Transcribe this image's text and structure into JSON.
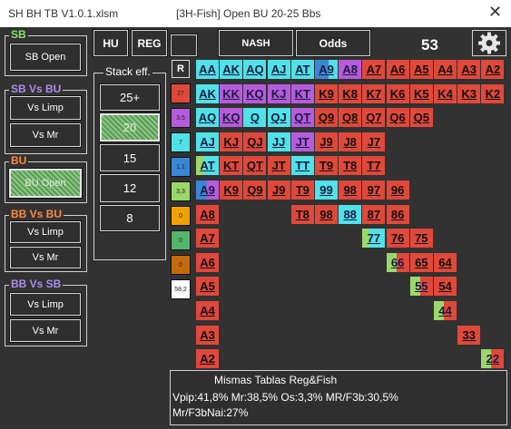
{
  "window": {
    "file_name": "SH BH TB V1.0.1.xlsm",
    "title": "[3H-Fish] Open BU 20-25 Bbs",
    "close_glyph": "✕"
  },
  "colors": {
    "raise_red": "#e0483a",
    "limp_purple": "#b65bdc",
    "call_cyan": "#50e2e8",
    "light_blue": "#3a86d8",
    "lime": "#9bd86a",
    "orange": "#f2a200",
    "green": "#55b56a"
  },
  "sidebar": {
    "sb": {
      "title": "SB",
      "open_label": "SB Open"
    },
    "sb_vs_bu": {
      "title": "SB Vs BU",
      "limp_label": "Vs Limp",
      "mr_label": "Vs Mr"
    },
    "bu": {
      "title": "BU",
      "open_label": "BU Open"
    },
    "bb_vs_bu": {
      "title": "BB Vs BU",
      "limp_label": "Vs Limp",
      "mr_label": "Vs Mr"
    },
    "bb_vs_sb": {
      "title": "BB Vs SB",
      "limp_label": "Vs Limp",
      "mr_label": "Vs Mr"
    }
  },
  "top": {
    "hu_label": "HU",
    "reg_label": "REG",
    "nash_label": "NASH",
    "odds_label": "Odds",
    "counter": "53",
    "gear_icon": "gear-icon"
  },
  "stack": {
    "title": "Stack eff.",
    "options": [
      "25+",
      "20",
      "15",
      "12",
      "8"
    ],
    "selected": "20"
  },
  "legend": {
    "header": "R",
    "values": [
      "27",
      "3,5",
      "7",
      "1,1",
      "3,3",
      "0",
      "0",
      "0",
      "58,2"
    ]
  },
  "summary": {
    "title": "Mismas Tablas Reg&Fish",
    "line1": "Vpip:41,8% Mr:38,5% Os:3,3% MR/F3b:30,5%",
    "line2": "Mr/F3bNai:27%"
  },
  "hands": [
    [
      "AA",
      "AK",
      "AQ",
      "AJ",
      "AT",
      "A9",
      "A8",
      "A7",
      "A6",
      "A5",
      "A4",
      "A3",
      "A2"
    ],
    [
      "AK",
      "KK",
      "KQ",
      "KJ",
      "KT",
      "K9",
      "K8",
      "K7",
      "K6",
      "K5",
      "K4",
      "K3",
      "K2"
    ],
    [
      "AQ",
      "KQ",
      "Q",
      "QJ",
      "QT",
      "Q9",
      "Q8",
      "Q7",
      "Q6",
      "Q5",
      "",
      "",
      ""
    ],
    [
      "AJ",
      "KJ",
      "QJ",
      "JJ",
      "JT",
      "J9",
      "J8",
      "J7",
      "",
      "",
      "",
      "",
      ""
    ],
    [
      "AT",
      "KT",
      "QT",
      "JT",
      "TT",
      "T9",
      "T8",
      "T7",
      "",
      "",
      "",
      "",
      ""
    ],
    [
      "A9",
      "K9",
      "Q9",
      "J9",
      "T9",
      "99",
      "98",
      "97",
      "96",
      "",
      "",
      "",
      ""
    ],
    [
      "A8",
      "",
      "",
      "",
      "T8",
      "98",
      "88",
      "87",
      "86",
      "",
      "",
      "",
      ""
    ],
    [
      "A7",
      "",
      "",
      "",
      "",
      "",
      "",
      "77",
      "76",
      "75",
      "",
      "",
      ""
    ],
    [
      "A6",
      "",
      "",
      "",
      "",
      "",
      "",
      "",
      "66",
      "65",
      "64",
      "",
      ""
    ],
    [
      "A5",
      "",
      "",
      "",
      "",
      "",
      "",
      "",
      "",
      "55",
      "54",
      "",
      ""
    ],
    [
      "A4",
      "",
      "",
      "",
      "",
      "",
      "",
      "",
      "",
      "",
      "44",
      "",
      ""
    ],
    [
      "A3",
      "",
      "",
      "",
      "",
      "",
      "",
      "",
      "",
      "",
      "",
      "33",
      ""
    ],
    [
      "A2",
      "",
      "",
      "",
      "",
      "",
      "",
      "",
      "",
      "",
      "",
      "",
      "22"
    ]
  ],
  "hand_colors": [
    [
      "C",
      "C",
      "C",
      "C",
      "C",
      "B",
      "P",
      "R",
      "R",
      "R",
      "R",
      "R",
      "R"
    ],
    [
      "C",
      "P",
      "P",
      "P",
      "P",
      "R",
      "R",
      "R",
      "R",
      "R",
      "R",
      "R",
      "R"
    ],
    [
      "C",
      "P",
      "C",
      "C",
      "P",
      "R",
      "R",
      "R",
      "R",
      "R",
      "",
      "",
      ""
    ],
    [
      "C",
      "R",
      "R",
      "C",
      "P",
      "R",
      "R",
      "R",
      "",
      "",
      "",
      "",
      ""
    ],
    [
      "CL",
      "R",
      "R",
      "R",
      "C",
      "R",
      "R",
      "R",
      "",
      "",
      "",
      "",
      ""
    ],
    [
      "PB",
      "R",
      "R",
      "R",
      "R",
      "C",
      "R",
      "R",
      "R",
      "",
      "",
      "",
      ""
    ],
    [
      "R",
      "",
      "",
      "",
      "R",
      "R",
      "C",
      "R",
      "R",
      "",
      "",
      "",
      ""
    ],
    [
      "R",
      "",
      "",
      "",
      "",
      "",
      "",
      "LC",
      "R",
      "R",
      "",
      "",
      ""
    ],
    [
      "R",
      "",
      "",
      "",
      "",
      "",
      "",
      "",
      "L",
      "R",
      "R",
      "",
      ""
    ],
    [
      "R",
      "",
      "",
      "",
      "",
      "",
      "",
      "",
      "",
      "L",
      "R",
      "",
      ""
    ],
    [
      "R",
      "",
      "",
      "",
      "",
      "",
      "",
      "",
      "",
      "",
      "L",
      "",
      ""
    ],
    [
      "R",
      "",
      "",
      "",
      "",
      "",
      "",
      "",
      "",
      "",
      "",
      "R",
      ""
    ],
    [
      "R",
      "",
      "",
      "",
      "",
      "",
      "",
      "",
      "",
      "",
      "",
      "",
      "L"
    ]
  ]
}
